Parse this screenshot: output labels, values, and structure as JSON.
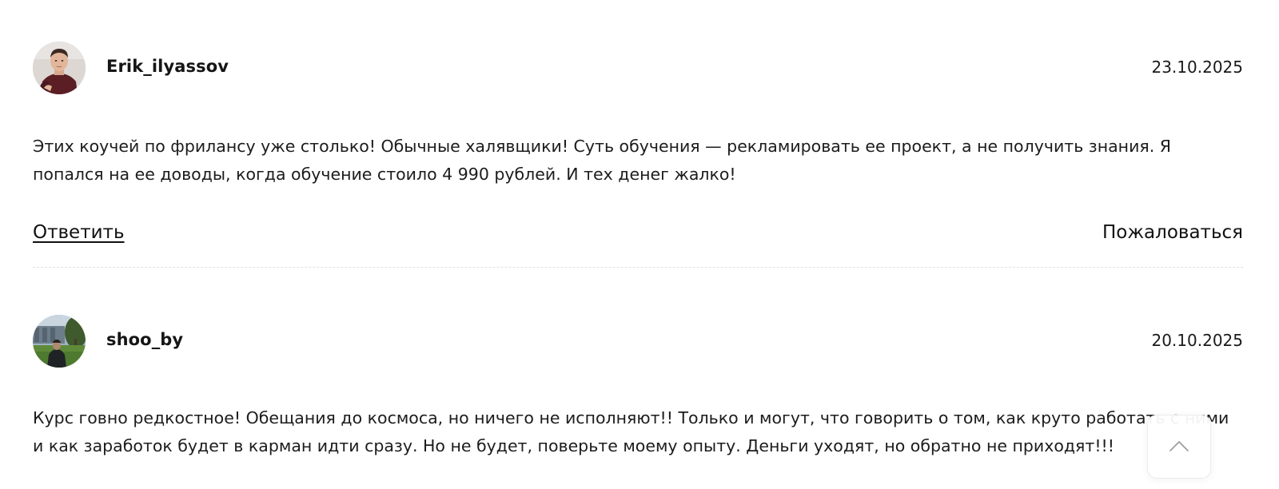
{
  "comments": [
    {
      "username": "Erik_ilyassov",
      "date": "23.10.2025",
      "text": "Этих коучей по фрилансу уже столько! Обычные халявщики! Суть обучения — рекламировать ее проект, а не получить знания. Я попался на ее доводы, когда обучение стоило 4 990 рублей. И тех денег жалко!",
      "reply_label": "Ответить",
      "report_label": "Пожаловаться"
    },
    {
      "username": "shoo_by",
      "date": "20.10.2025",
      "text": "Курс говно редкостное! Обещания до космоса, но ничего не исполняют!! Только и могут, что говорить о том, как круто работать с ними и как заработок будет в карман идти сразу. Но не будет, поверьте моему опыту. Деньги уходят, но обратно не приходят!!!"
    }
  ],
  "icons": {
    "avatar_1": "user-photo",
    "avatar_2": "user-photo",
    "scroll_top": "chevron-up-icon"
  }
}
